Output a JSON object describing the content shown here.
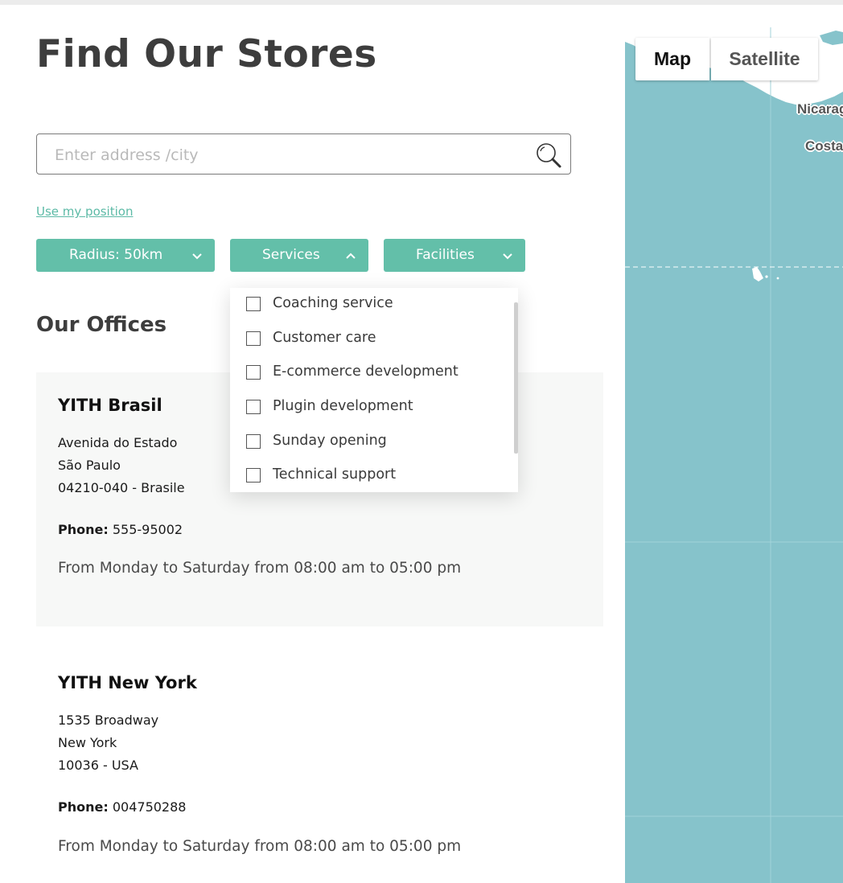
{
  "page": {
    "title": "Find Our Stores"
  },
  "search": {
    "placeholder": "Enter address /city",
    "value": ""
  },
  "use_position_label": "Use my position",
  "filters": {
    "radius_label": "Radius: 50km",
    "services_label": "Services",
    "facilities_label": "Facilities"
  },
  "services_dropdown": {
    "items": [
      {
        "label": "Coaching service",
        "checked": false
      },
      {
        "label": "Customer care",
        "checked": false
      },
      {
        "label": "E-commerce development",
        "checked": false
      },
      {
        "label": "Plugin development",
        "checked": false
      },
      {
        "label": "Sunday opening",
        "checked": false
      },
      {
        "label": "Technical support",
        "checked": false
      }
    ]
  },
  "offices_title": "Our Offices",
  "offices": [
    {
      "name": "YITH Brasil",
      "address": [
        "Avenida do Estado",
        "São Paulo",
        "04210-040 - Brasile"
      ],
      "phone_label": "Phone:",
      "phone": "555-95002",
      "hours": "From Monday to Saturday from 08:00 am to 05:00 pm"
    },
    {
      "name": "YITH New York",
      "address": [
        "1535 Broadway",
        "New York",
        "10036 - USA"
      ],
      "phone_label": "Phone:",
      "phone": "004750288",
      "hours": "From Monday to Saturday from 08:00 am to 05:00 pm"
    }
  ],
  "map": {
    "map_label": "Map",
    "satellite_label": "Satellite",
    "place_labels": [
      "Nicarag",
      "Costa"
    ]
  },
  "colors": {
    "accent": "#63bfa9",
    "link": "#5cbaa6",
    "ocean": "#86c3cb",
    "land": "#ffffff"
  }
}
